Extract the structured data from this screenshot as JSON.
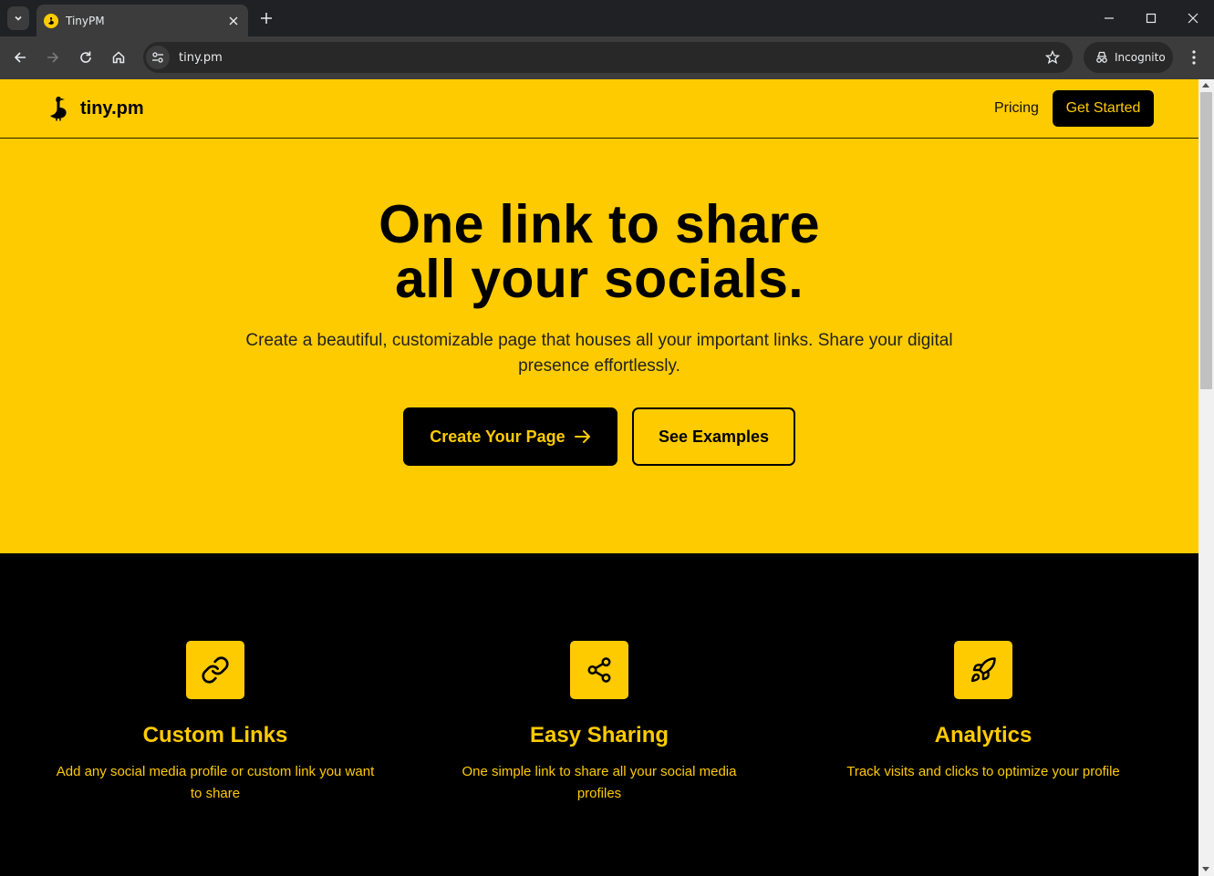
{
  "browser": {
    "tab_title": "TinyPM",
    "url": "tiny.pm",
    "incognito_label": "Incognito"
  },
  "site": {
    "brand": "tiny.pm",
    "nav": {
      "pricing": "Pricing",
      "get_started": "Get Started"
    },
    "hero": {
      "title_line1": "One link to share",
      "title_line2": "all your socials.",
      "subtitle": "Create a beautiful, customizable page that houses all your important links. Share your digital presence effortlessly.",
      "primary_cta": "Create Your Page",
      "secondary_cta": "See Examples"
    },
    "features": [
      {
        "icon": "link-icon",
        "title": "Custom Links",
        "description": "Add any social media profile or custom link you want to share"
      },
      {
        "icon": "share-icon",
        "title": "Easy Sharing",
        "description": "One simple link to share all your social media profiles"
      },
      {
        "icon": "rocket-icon",
        "title": "Analytics",
        "description": "Track visits and clicks to optimize your profile"
      }
    ]
  },
  "colors": {
    "brand_yellow": "#fecb00",
    "black": "#000000",
    "chrome_dark": "#202124"
  }
}
